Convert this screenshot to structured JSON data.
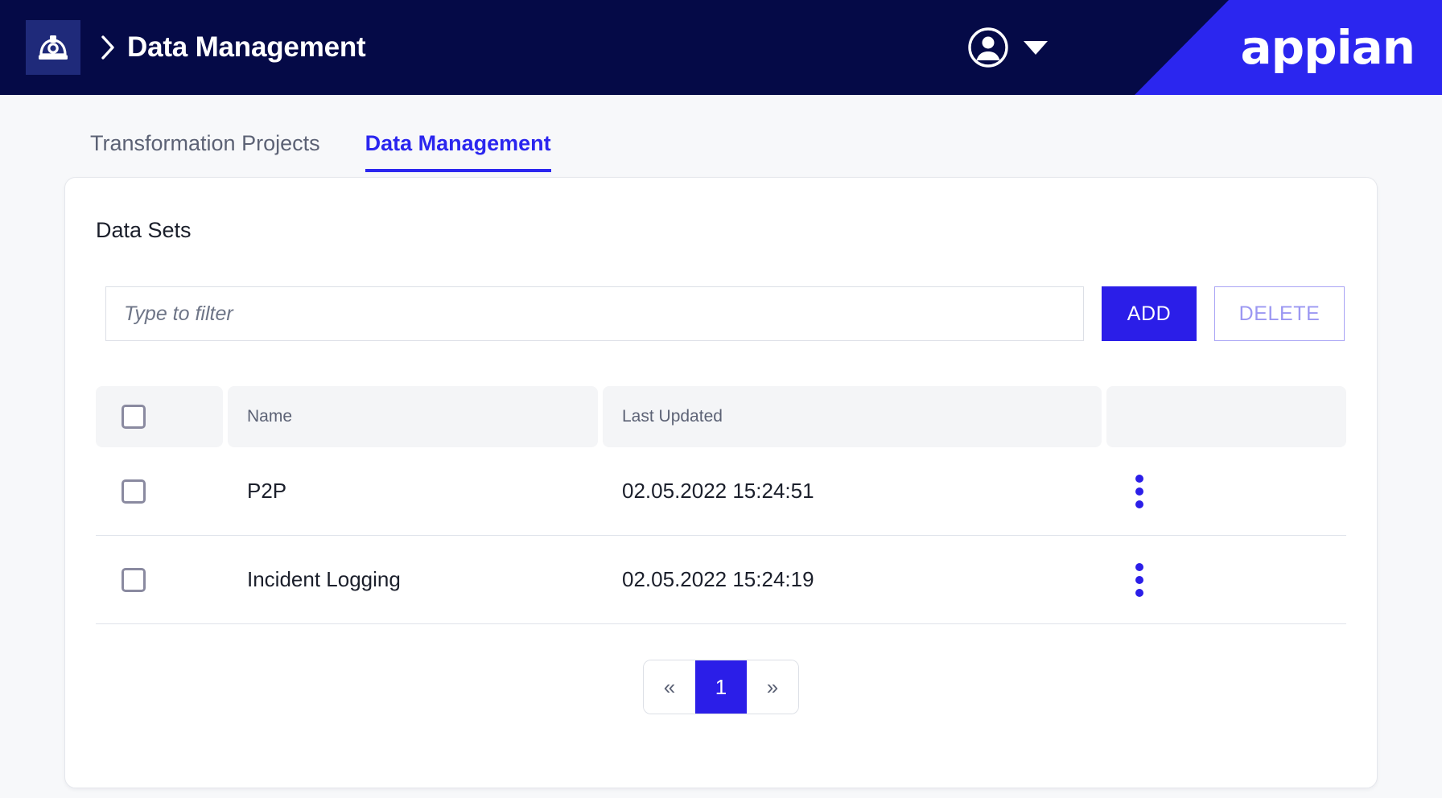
{
  "header": {
    "app_icon": "hard-hat-icon",
    "breadcrumb_separator": "›",
    "title": "Data Management",
    "user_icon": "user-avatar-icon",
    "caret_icon": "chevron-down-icon",
    "brand": "appian",
    "bar_color": "#050a47",
    "wedge_color": "#2b26ef"
  },
  "tabs": [
    {
      "label": "Transformation Projects",
      "active": false
    },
    {
      "label": "Data Management",
      "active": true
    }
  ],
  "card": {
    "title": "Data Sets"
  },
  "filter": {
    "value": "",
    "placeholder": "Type to filter"
  },
  "actions": {
    "add_label": "ADD",
    "delete_label": "DELETE",
    "add_color": "#2b1ee8",
    "delete_color": "#9b97f2"
  },
  "table": {
    "columns": [
      "",
      "Name",
      "Last Updated",
      ""
    ],
    "select_all_checked": false,
    "rows": [
      {
        "checked": false,
        "name": "P2P",
        "last_updated": "02.05.2022 15:24:51",
        "menu_icon": "kebab-menu-icon"
      },
      {
        "checked": false,
        "name": "Incident Logging",
        "last_updated": "02.05.2022 15:24:19",
        "menu_icon": "kebab-menu-icon"
      }
    ]
  },
  "pagination": {
    "prev_label": "«",
    "next_label": "»",
    "pages": [
      "1"
    ],
    "current_page": "1"
  }
}
